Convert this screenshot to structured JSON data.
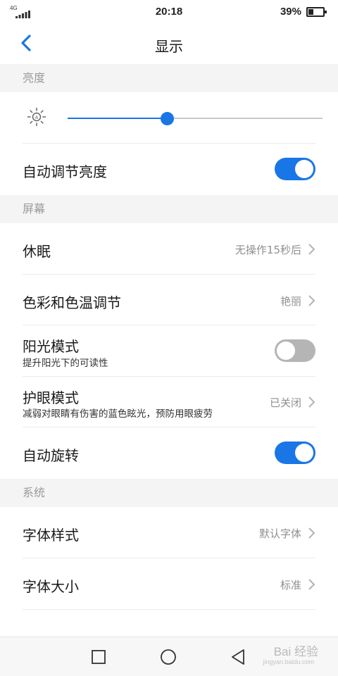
{
  "status_bar": {
    "network": "4G",
    "time": "20:18",
    "battery": "39%",
    "battery_level": 0.39
  },
  "header": {
    "title": "显示"
  },
  "sections": {
    "brightness": "亮度",
    "screen": "屏幕",
    "system": "系统"
  },
  "brightness": {
    "level": 0.39
  },
  "auto_brightness": {
    "label": "自动调节亮度",
    "enabled": true
  },
  "sleep": {
    "label": "休眠",
    "value": "无操作15秒后"
  },
  "color_temp": {
    "label": "色彩和色温调节",
    "value": "艳丽"
  },
  "sunlight_mode": {
    "label": "阳光模式",
    "desc": "提升阳光下的可读性",
    "enabled": false
  },
  "eye_care": {
    "label": "护眼模式",
    "desc": "减弱对眼睛有伤害的蓝色眩光，预防用眼疲劳",
    "value": "已关闭"
  },
  "auto_rotate": {
    "label": "自动旋转",
    "enabled": true
  },
  "font_style": {
    "label": "字体样式",
    "value": "默认字体"
  },
  "font_size": {
    "label": "字体大小",
    "value": "标准"
  },
  "watermark": {
    "text": "Bai 经验",
    "sub": "jingyan.baidu.com"
  },
  "icons": {
    "back": "chevron-left-icon",
    "sun": "sun-icon",
    "chevron": "chevron-right-icon",
    "recent": "square-icon",
    "home": "circle-icon",
    "nav_back": "triangle-back-icon"
  },
  "colors": {
    "accent": "#1976e6",
    "section_bg": "#f4f4f4",
    "toggle_off": "#b5b5b5"
  }
}
